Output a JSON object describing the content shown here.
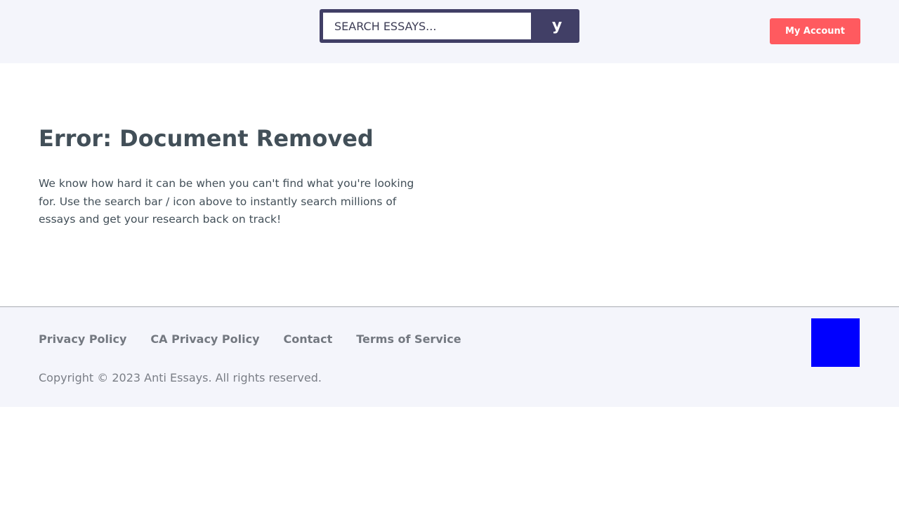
{
  "header": {
    "search": {
      "placeholder": "SEARCH ESSAYS...",
      "button_label": "y"
    },
    "account_button_label": "My Account"
  },
  "main": {
    "title": "Error: Document Removed",
    "message": "We know how hard it can be when you can't find what you're looking for. Use the search bar / icon above to instantly search millions of essays and get your research back on track!"
  },
  "footer": {
    "links": [
      {
        "label": "Privacy Policy"
      },
      {
        "label": "CA Privacy Policy"
      },
      {
        "label": "Contact"
      },
      {
        "label": "Terms of Service"
      }
    ],
    "copyright": "Copyright © 2023 Anti Essays. All rights reserved."
  },
  "colors": {
    "header_bg": "#f4f5fb",
    "search_frame": "#413f66",
    "account_button": "#ff5a5f",
    "text_dark": "#424f58",
    "footer_text": "#737880",
    "badge_square": "#0000ff"
  }
}
